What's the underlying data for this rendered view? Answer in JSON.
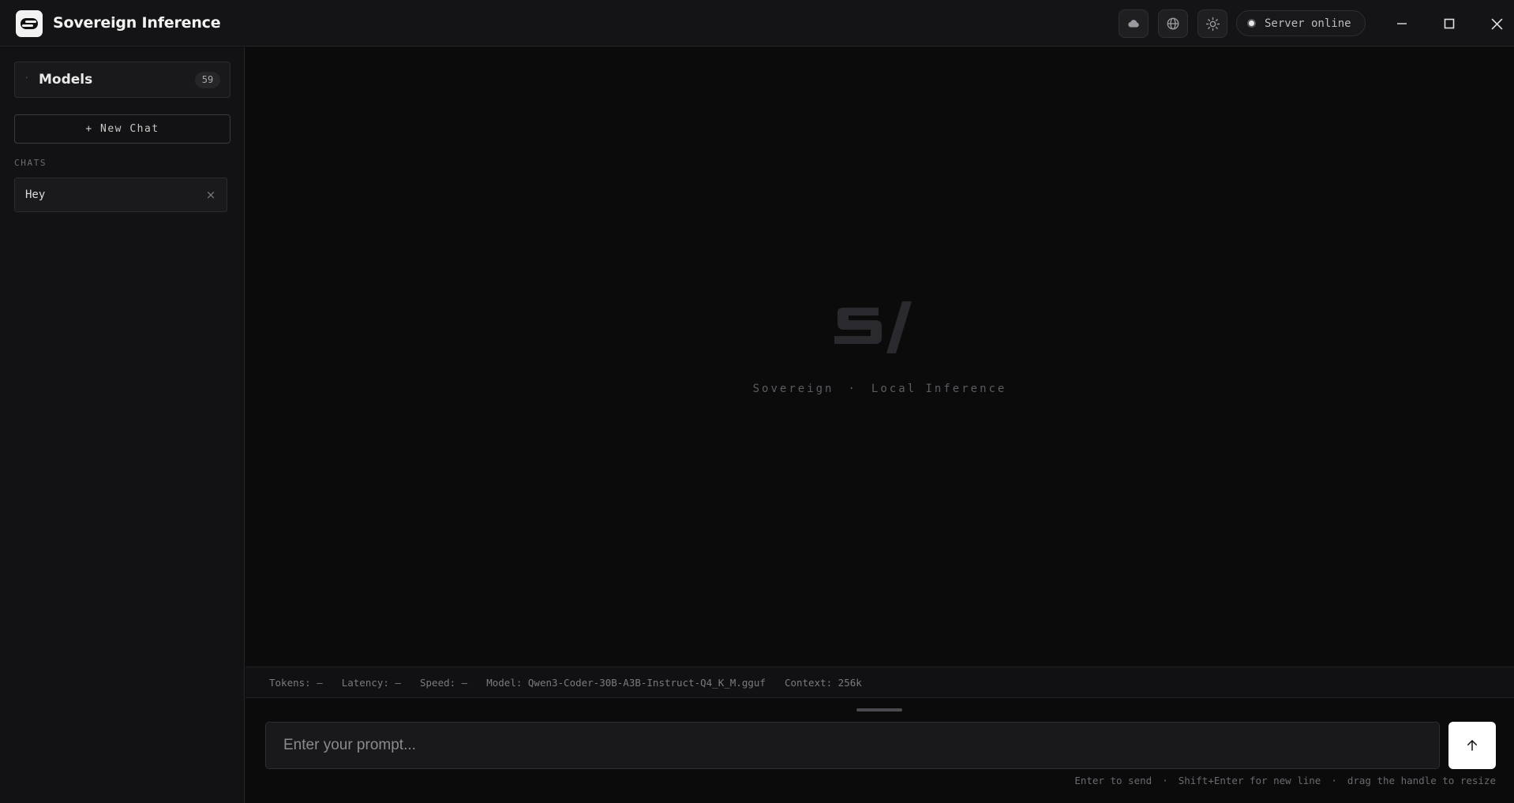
{
  "app": {
    "title": "Sovereign Inference",
    "logo_icon": "sovereign-s-logo"
  },
  "header": {
    "buttons": [
      {
        "icon": "cloud-icon"
      },
      {
        "icon": "globe-icon"
      },
      {
        "icon": "sun-icon"
      }
    ],
    "server_status": "Server online",
    "window_controls": [
      "minimize-icon",
      "maximize-icon",
      "close-icon"
    ]
  },
  "sidebar": {
    "models_label": "Models",
    "models_count": "59",
    "models_bullet": "·",
    "new_chat_label": "+ New Chat",
    "chats_heading": "CHATS",
    "chats": [
      {
        "label": "Hey",
        "close_glyph": "×"
      }
    ]
  },
  "main": {
    "hero_mark": "s/",
    "tagline_left": "Sovereign",
    "tagline_sep": "·",
    "tagline_right": "Local Inference"
  },
  "stats": {
    "tokens": "Tokens: —",
    "latency": "Latency: —",
    "speed": "Speed: —",
    "model": "Model: Qwen3-Coder-30B-A3B-Instruct-Q4_K_M.gguf",
    "context": "Context: 256k"
  },
  "composer": {
    "placeholder": "Enter your prompt...",
    "value": "",
    "send_icon": "arrow-up-icon",
    "hint_send": "Enter to send",
    "hint_newline": "Shift+Enter for new line",
    "hint_resize": "drag the handle to resize",
    "hint_sep": "·"
  },
  "colors": {
    "background": "#0b0b0c",
    "panel": "#121214",
    "accent": "#ffffff",
    "muted_text": "#7a7a80"
  }
}
